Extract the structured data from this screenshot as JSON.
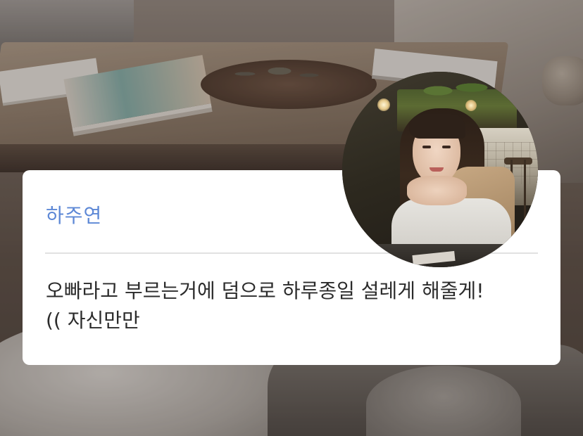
{
  "message_card": {
    "sender_name": "하주연",
    "message_line_1": "오빠라고 부르는거에 덤으로 하루종일 설레게 해줄게!",
    "message_line_2": "(( 자신만만"
  },
  "avatar": {
    "icon": "profile-photo"
  },
  "colors": {
    "sender_name": "#5d88d6",
    "card_background": "#ffffff",
    "divider": "#e1e1e1",
    "message_text": "#2b2b2b"
  }
}
